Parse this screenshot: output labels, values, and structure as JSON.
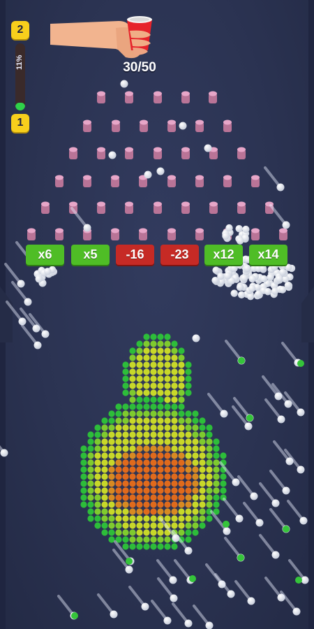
{
  "level": {
    "current": "1",
    "next": "2",
    "progress_text": "11%",
    "progress_fraction": 0.11
  },
  "counter": {
    "text": "30/50"
  },
  "multipliers": [
    {
      "label": "x6",
      "kind": "bonus"
    },
    {
      "label": "x5",
      "kind": "bonus"
    },
    {
      "label": "-16",
      "kind": "penalty"
    },
    {
      "label": "-23",
      "kind": "penalty"
    },
    {
      "label": "x12",
      "kind": "bonus"
    },
    {
      "label": "x14",
      "kind": "bonus"
    }
  ],
  "colors": {
    "background": "#2c3453",
    "peg": "#e7a6c8",
    "bonus": "#4fbd26",
    "penalty": "#c62a25",
    "ball": "#ffffff",
    "badge": "#f7cf1c",
    "progress": "#2fd24a"
  },
  "icons": {
    "hand": "hand-holding-cup-icon"
  }
}
